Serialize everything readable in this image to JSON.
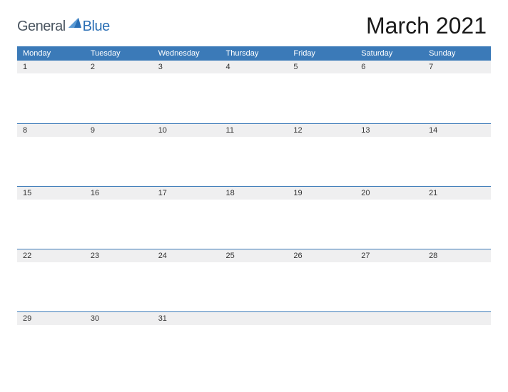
{
  "logo": {
    "text_general": "General",
    "text_blue": "Blue"
  },
  "title": "March 2021",
  "day_headers": [
    "Monday",
    "Tuesday",
    "Wednesday",
    "Thursday",
    "Friday",
    "Saturday",
    "Sunday"
  ],
  "weeks": [
    [
      "1",
      "2",
      "3",
      "4",
      "5",
      "6",
      "7"
    ],
    [
      "8",
      "9",
      "10",
      "11",
      "12",
      "13",
      "14"
    ],
    [
      "15",
      "16",
      "17",
      "18",
      "19",
      "20",
      "21"
    ],
    [
      "22",
      "23",
      "24",
      "25",
      "26",
      "27",
      "28"
    ],
    [
      "29",
      "30",
      "31",
      "",
      "",
      "",
      ""
    ]
  ]
}
